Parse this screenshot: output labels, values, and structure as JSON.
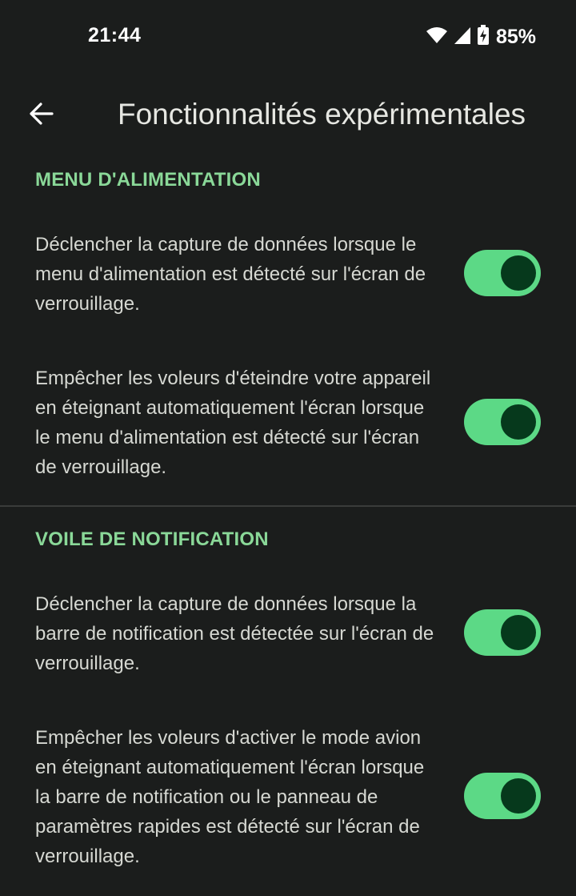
{
  "status_bar": {
    "time": "21:44",
    "battery_percent": "85%",
    "icons": [
      "wifi-icon",
      "cellular-signal-icon",
      "battery-charging-icon"
    ]
  },
  "app_bar": {
    "back_icon": "arrow-back-icon",
    "title": "Fonctionnalités expérimentales"
  },
  "sections": [
    {
      "header": "MENU D'ALIMENTATION",
      "items": [
        {
          "text": "Déclencher la capture de données lorsque le menu d'alimentation est détecté sur l'écran de verrouillage.",
          "enabled": true
        },
        {
          "text": "Empêcher les voleurs d'éteindre votre appareil en éteignant automatiquement l'écran lorsque le menu d'alimentation est détecté sur l'écran de verrouillage.",
          "enabled": true
        }
      ]
    },
    {
      "header": "VOILE DE NOTIFICATION",
      "items": [
        {
          "text": "Déclencher la capture de données lorsque la barre de notification est détectée sur l'écran de verrouillage.",
          "enabled": true
        },
        {
          "text": "Empêcher les voleurs d'activer le mode avion en éteignant automatiquement l'écran lorsque la barre de notification ou le panneau de paramètres rapides est détecté sur l'écran de verrouillage.",
          "enabled": true
        }
      ]
    }
  ],
  "colors": {
    "background": "#1b1d1c",
    "accent": "#8ad898",
    "switch_track_on": "#5cd986",
    "switch_thumb_on": "#06391c"
  }
}
